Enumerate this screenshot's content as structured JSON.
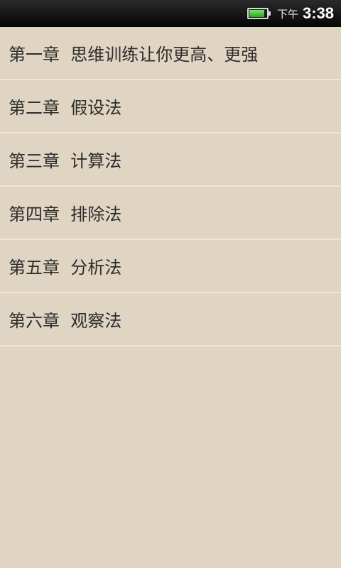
{
  "status_bar": {
    "ampm": "下午",
    "time": "3:38",
    "battery_icon": "battery-icon",
    "battery_level": 0.9,
    "battery_color": "#4cd23a"
  },
  "chapters": [
    {
      "label": "第一章  思维训练让你更高、更强"
    },
    {
      "label": "第二章  假设法"
    },
    {
      "label": "第三章  计算法"
    },
    {
      "label": "第四章  排除法"
    },
    {
      "label": "第五章  分析法"
    },
    {
      "label": "第六章  观察法"
    }
  ]
}
